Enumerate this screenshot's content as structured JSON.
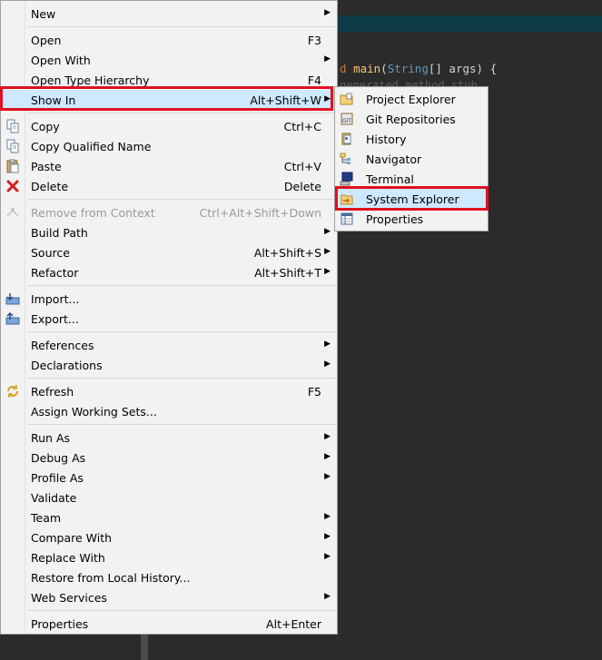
{
  "editor": {
    "code_line_kw": "d",
    "code_line_main": "main",
    "code_line_type": "String",
    "code_line_rest": "[] args) {",
    "comment_line": "generated method stub"
  },
  "main_menu": {
    "new": {
      "label": "New"
    },
    "open": {
      "label": "Open",
      "shortcut": "F3"
    },
    "open_with": {
      "label": "Open With"
    },
    "open_type_hierarchy": {
      "label": "Open Type Hierarchy",
      "shortcut": "F4"
    },
    "show_in": {
      "label": "Show In",
      "shortcut": "Alt+Shift+W"
    },
    "copy": {
      "label": "Copy",
      "shortcut": "Ctrl+C"
    },
    "copy_qualified": {
      "label": "Copy Qualified Name"
    },
    "paste": {
      "label": "Paste",
      "shortcut": "Ctrl+V"
    },
    "delete": {
      "label": "Delete",
      "shortcut": "Delete"
    },
    "remove_context": {
      "label": "Remove from Context",
      "shortcut": "Ctrl+Alt+Shift+Down"
    },
    "build_path": {
      "label": "Build Path"
    },
    "source": {
      "label": "Source",
      "shortcut": "Alt+Shift+S"
    },
    "refactor": {
      "label": "Refactor",
      "shortcut": "Alt+Shift+T"
    },
    "import": {
      "label": "Import..."
    },
    "export": {
      "label": "Export..."
    },
    "references": {
      "label": "References"
    },
    "declarations": {
      "label": "Declarations"
    },
    "refresh": {
      "label": "Refresh",
      "shortcut": "F5"
    },
    "assign_working_sets": {
      "label": "Assign Working Sets..."
    },
    "run_as": {
      "label": "Run As"
    },
    "debug_as": {
      "label": "Debug As"
    },
    "profile_as": {
      "label": "Profile As"
    },
    "validate": {
      "label": "Validate"
    },
    "team": {
      "label": "Team"
    },
    "compare_with": {
      "label": "Compare With"
    },
    "replace_with": {
      "label": "Replace With"
    },
    "restore_local_history": {
      "label": "Restore from Local History..."
    },
    "web_services": {
      "label": "Web Services"
    },
    "properties": {
      "label": "Properties",
      "shortcut": "Alt+Enter"
    },
    "submenu_arrow": "▶"
  },
  "sub_menu": {
    "project_explorer": "Project Explorer",
    "git_repositories": "Git Repositories",
    "history": "History",
    "navigator": "Navigator",
    "terminal": "Terminal",
    "system_explorer": "System Explorer",
    "properties": "Properties"
  },
  "colors": {
    "highlight": "#cde8ff",
    "annotation_red": "#e0101e",
    "menu_bg": "#f2f2f2",
    "editor_bg": "#2b2b2b"
  }
}
